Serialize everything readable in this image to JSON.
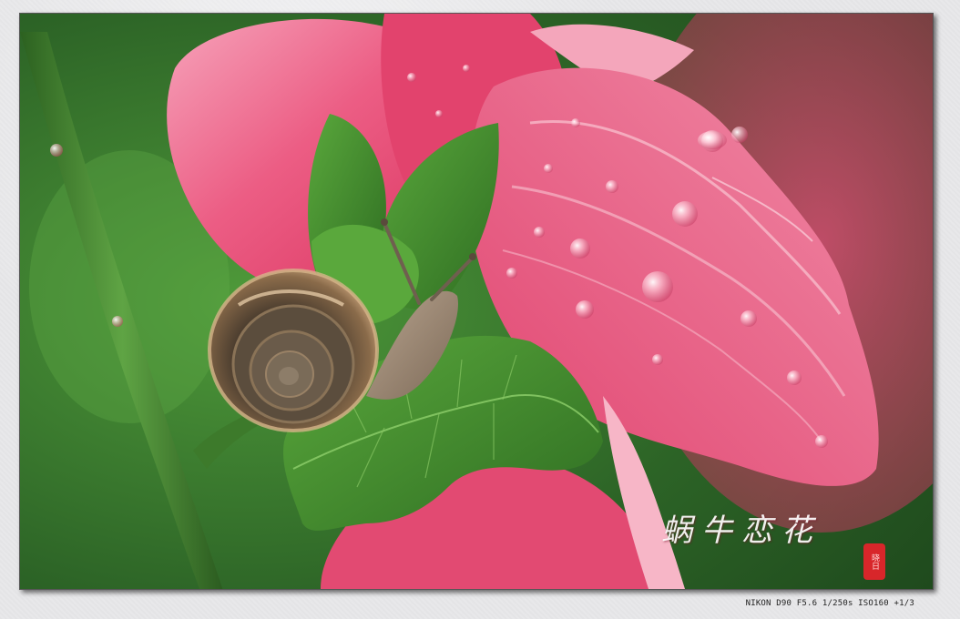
{
  "photo": {
    "subject": "snail-on-hollyhock",
    "calligraphy_title": "蜗牛恋花",
    "seal_text": "晓日",
    "exif_caption": "NIKON D90 F5.6 1/250s ISO160 +1/3"
  },
  "colors": {
    "mat": "#e8e8ea",
    "petal_main": "#e8446f",
    "petal_light": "#f7a7bd",
    "leaf": "#3f8a2e",
    "stem": "#3d7a2b",
    "background_green": "#2f6a2a",
    "seal_red": "#d8262a"
  }
}
